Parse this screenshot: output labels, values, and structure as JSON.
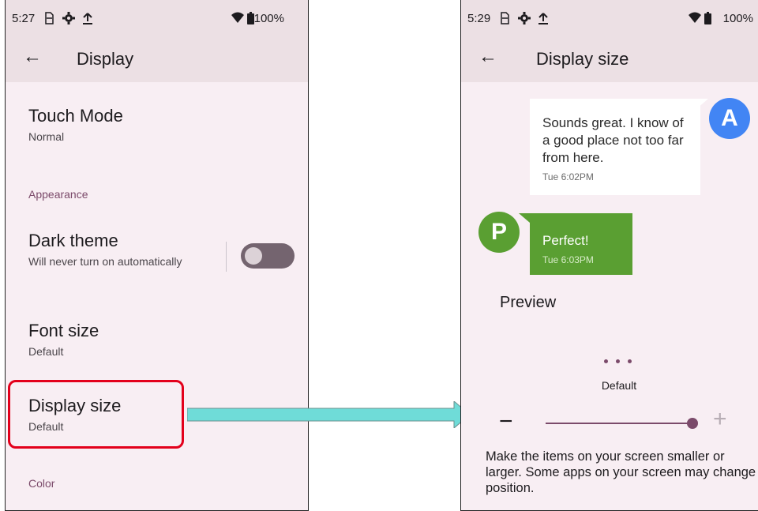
{
  "left_screen": {
    "status": {
      "time": "5:27",
      "battery": "100%"
    },
    "appbar": {
      "title": "Display"
    },
    "items": [
      {
        "title": "Touch Mode",
        "subtitle": "Normal"
      },
      {
        "title": "Dark theme",
        "subtitle": "Will never turn on automatically",
        "toggle_on": false
      },
      {
        "title": "Font size",
        "subtitle": "Default"
      },
      {
        "title": "Display size",
        "subtitle": "Default"
      }
    ],
    "sections": {
      "appearance": "Appearance",
      "color": "Color"
    }
  },
  "right_screen": {
    "status": {
      "time": "5:29",
      "battery": "100%"
    },
    "appbar": {
      "title": "Display size"
    },
    "messages": [
      {
        "avatar": "A",
        "text": "Sounds great. I know of a good place not too far from here.",
        "time": "Tue 6:02PM"
      },
      {
        "avatar": "P",
        "text": "Perfect!",
        "time": "Tue 6:03PM"
      }
    ],
    "preview_label": "Preview",
    "size_label": "Default",
    "minus_symbol": "−",
    "plus_symbol": "+",
    "slider_level": 1.0,
    "description": "Make the items on your screen smaller or larger. Some apps on your screen may change position."
  },
  "colors": {
    "accent": "#7b4a6a",
    "appbar": "#ece0e4",
    "highlight": "#e3001b",
    "avatar_a": "#4285f4",
    "avatar_p": "#5a9f32",
    "arrow": "#6fdcd8"
  },
  "icons": [
    "back-arrow-icon",
    "sim-icon",
    "settings-gear-icon",
    "upload-icon",
    "wifi-icon",
    "battery-icon"
  ]
}
